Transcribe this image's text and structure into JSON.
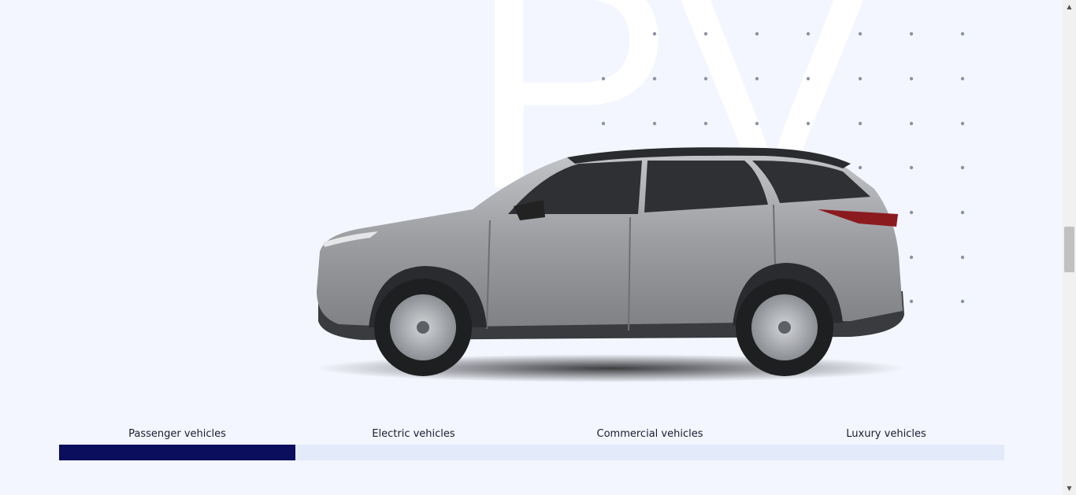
{
  "hero": {
    "background_letters": "PV",
    "vehicle_image": "grey-suv-side-view"
  },
  "tabs": {
    "items": [
      {
        "label": "Passenger vehicles"
      },
      {
        "label": "Electric vehicles"
      },
      {
        "label": "Commercial vehicles"
      },
      {
        "label": "Luxury vehicles"
      }
    ],
    "active_index": 0,
    "progress": 0.25
  },
  "colors": {
    "background": "#f3f6fe",
    "accent": "#0b0e5c",
    "track": "#e3eafa",
    "dot": "#8d93a3",
    "car_body": "#9a9ca0"
  },
  "scrollbar": {
    "up_icon": "triangle-up-icon",
    "down_icon": "triangle-down-icon"
  }
}
